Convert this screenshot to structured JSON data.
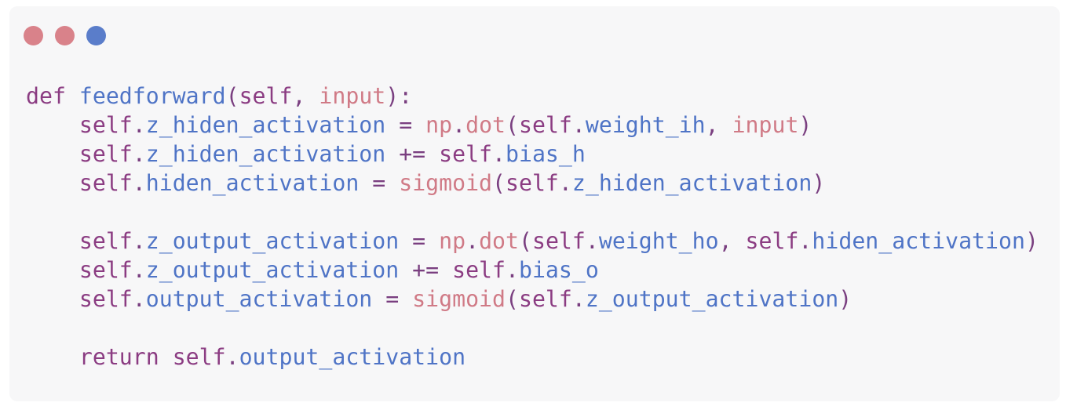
{
  "window": {
    "controls": [
      {
        "name": "close-dot",
        "color": "#d9828a"
      },
      {
        "name": "minimize-dot",
        "color": "#d9828a"
      },
      {
        "name": "maximize-dot",
        "color": "#5a7dca"
      }
    ]
  },
  "colors": {
    "keyword": "#8b3c82",
    "func": "#4f74c6",
    "self": "#8b3c82",
    "attr": "#4f74c6",
    "punct": "#7a3f80",
    "param": "#d07a86",
    "call": "#d07a86",
    "plain": "#7a3f80"
  },
  "code": {
    "lines": [
      [
        [
          "keyword",
          "def "
        ],
        [
          "func",
          "feedforward"
        ],
        [
          "punct",
          "("
        ],
        [
          "self",
          "self"
        ],
        [
          "punct",
          ", "
        ],
        [
          "param",
          "input"
        ],
        [
          "punct",
          "):"
        ]
      ],
      [
        [
          "plain",
          "    "
        ],
        [
          "self",
          "self"
        ],
        [
          "punct",
          "."
        ],
        [
          "attr",
          "z_hiden_activation"
        ],
        [
          "punct",
          " = "
        ],
        [
          "call",
          "np"
        ],
        [
          "punct",
          "."
        ],
        [
          "call",
          "dot"
        ],
        [
          "punct",
          "("
        ],
        [
          "self",
          "self"
        ],
        [
          "punct",
          "."
        ],
        [
          "attr",
          "weight_ih"
        ],
        [
          "punct",
          ", "
        ],
        [
          "param",
          "input"
        ],
        [
          "punct",
          ")"
        ]
      ],
      [
        [
          "plain",
          "    "
        ],
        [
          "self",
          "self"
        ],
        [
          "punct",
          "."
        ],
        [
          "attr",
          "z_hiden_activation"
        ],
        [
          "punct",
          " += "
        ],
        [
          "self",
          "self"
        ],
        [
          "punct",
          "."
        ],
        [
          "attr",
          "bias_h"
        ]
      ],
      [
        [
          "plain",
          "    "
        ],
        [
          "self",
          "self"
        ],
        [
          "punct",
          "."
        ],
        [
          "attr",
          "hiden_activation"
        ],
        [
          "punct",
          " = "
        ],
        [
          "call",
          "sigmoid"
        ],
        [
          "punct",
          "("
        ],
        [
          "self",
          "self"
        ],
        [
          "punct",
          "."
        ],
        [
          "attr",
          "z_hiden_activation"
        ],
        [
          "punct",
          ")"
        ]
      ],
      [],
      [
        [
          "plain",
          "    "
        ],
        [
          "self",
          "self"
        ],
        [
          "punct",
          "."
        ],
        [
          "attr",
          "z_output_activation"
        ],
        [
          "punct",
          " = "
        ],
        [
          "call",
          "np"
        ],
        [
          "punct",
          "."
        ],
        [
          "call",
          "dot"
        ],
        [
          "punct",
          "("
        ],
        [
          "self",
          "self"
        ],
        [
          "punct",
          "."
        ],
        [
          "attr",
          "weight_ho"
        ],
        [
          "punct",
          ", "
        ],
        [
          "self",
          "self"
        ],
        [
          "punct",
          "."
        ],
        [
          "attr",
          "hiden_activation"
        ],
        [
          "punct",
          ")"
        ]
      ],
      [
        [
          "plain",
          "    "
        ],
        [
          "self",
          "self"
        ],
        [
          "punct",
          "."
        ],
        [
          "attr",
          "z_output_activation"
        ],
        [
          "punct",
          " += "
        ],
        [
          "self",
          "self"
        ],
        [
          "punct",
          "."
        ],
        [
          "attr",
          "bias_o"
        ]
      ],
      [
        [
          "plain",
          "    "
        ],
        [
          "self",
          "self"
        ],
        [
          "punct",
          "."
        ],
        [
          "attr",
          "output_activation"
        ],
        [
          "punct",
          " = "
        ],
        [
          "call",
          "sigmoid"
        ],
        [
          "punct",
          "("
        ],
        [
          "self",
          "self"
        ],
        [
          "punct",
          "."
        ],
        [
          "attr",
          "z_output_activation"
        ],
        [
          "punct",
          ")"
        ]
      ],
      [],
      [
        [
          "plain",
          "    "
        ],
        [
          "keyword",
          "return "
        ],
        [
          "self",
          "self"
        ],
        [
          "punct",
          "."
        ],
        [
          "attr",
          "output_activation"
        ]
      ]
    ]
  }
}
